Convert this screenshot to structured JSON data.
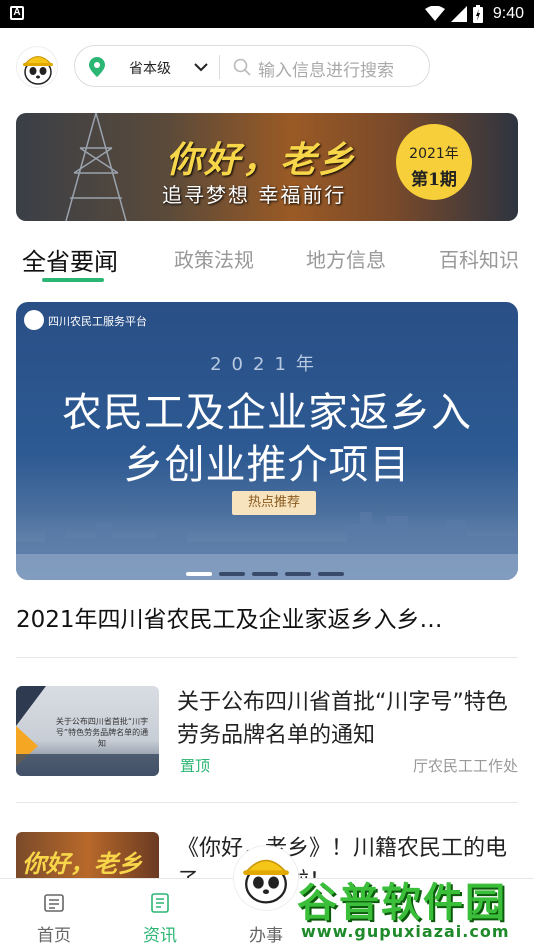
{
  "status_bar": {
    "time": "9:40"
  },
  "header": {
    "region": "省本级",
    "search_placeholder": "输入信息进行搜索"
  },
  "banner": {
    "title": "你好，老乡",
    "subtitle": "追寻梦想 幸福前行",
    "badge_year": "2021年",
    "badge_issue": "第1期"
  },
  "tabs": [
    {
      "label": "全省要闻",
      "active": true
    },
    {
      "label": "政策法规"
    },
    {
      "label": "地方信息"
    },
    {
      "label": "百科知识"
    }
  ],
  "hero": {
    "org": "四川农民工服务平台",
    "year": "2021年",
    "line1": "农民工及企业家返乡入",
    "line2": "乡创业推介项目",
    "hot": "热点推荐",
    "caption": "2021年四川省农民工及企业家返乡入乡…"
  },
  "news": [
    {
      "title": "关于公布四川省首批“川字号”特色劳务品牌名单的通知",
      "tag": "置顶",
      "source": "厅农民工工作处",
      "thumb_text": "关于公布四川省首批“川字号”特色劳务品牌名单的通知"
    },
    {
      "title": "《你好，老乡》！川籍农民工的电子……上线啦！",
      "thumb_text": "你好，老乡"
    }
  ],
  "bottom_nav": [
    {
      "label": "首页"
    },
    {
      "label": "资讯",
      "active": true
    },
    {
      "label": "办事"
    }
  ],
  "watermark": {
    "big": "谷普软件园",
    "small": "www.gupuxiazai.com"
  },
  "colors": {
    "accent": "#2bb673",
    "badge": "#f6cf3a"
  }
}
